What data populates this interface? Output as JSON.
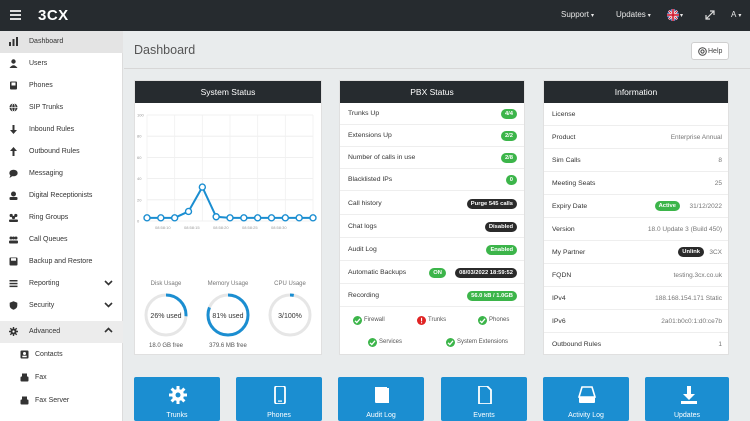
{
  "topbar": {
    "logo_number": "3",
    "logo_text": "CX",
    "support_label": "Support",
    "updates_label": "Updates",
    "user_label": "A",
    "icons": [
      "hamburger-icon",
      "uk-flag-icon",
      "expand-icon",
      "user-icon"
    ]
  },
  "sidebar": {
    "items": [
      {
        "label": "Dashboard",
        "icon": "dashboard-icon"
      },
      {
        "label": "Users",
        "icon": "user-icon"
      },
      {
        "label": "Phones",
        "icon": "phone-icon"
      },
      {
        "label": "SIP Trunks",
        "icon": "globe-icon"
      },
      {
        "label": "Inbound Rules",
        "icon": "arrow-down-icon"
      },
      {
        "label": "Outbound Rules",
        "icon": "arrow-up-icon"
      },
      {
        "label": "Messaging",
        "icon": "chat-icon"
      },
      {
        "label": "Digital Receptionists",
        "icon": "receptionist-icon"
      },
      {
        "label": "Ring Groups",
        "icon": "group-icon"
      },
      {
        "label": "Call Queues",
        "icon": "queue-icon"
      },
      {
        "label": "Backup and Restore",
        "icon": "disk-icon"
      },
      {
        "label": "Reporting",
        "icon": "report-icon"
      },
      {
        "label": "Security",
        "icon": "shield-icon"
      },
      {
        "label": "Advanced",
        "icon": "gear-icon"
      },
      {
        "label": "Contacts",
        "icon": "contacts-icon"
      },
      {
        "label": "Fax",
        "icon": "fax-icon"
      },
      {
        "label": "Fax Server",
        "icon": "fax-icon"
      }
    ]
  },
  "main": {
    "title": "Dashboard",
    "help_label": "Help"
  },
  "system_status": {
    "title": "System Status",
    "y_ticks": [
      "100",
      "80",
      "60",
      "40",
      "20",
      "0"
    ],
    "x_ticks": [
      "08:58:10",
      "08:58:15",
      "08:58:20",
      "08:58:25",
      "08:58:30"
    ],
    "gauges": [
      {
        "label": "Disk Usage",
        "value_text": "26% used",
        "percent": 26,
        "sub": "18.0 GB free"
      },
      {
        "label": "Memory Usage",
        "value_text": "81% used",
        "percent": 81,
        "sub": "379.6 MB free"
      },
      {
        "label": "CPU Usage",
        "value_text": "3/100%",
        "percent": 3,
        "sub": ""
      }
    ]
  },
  "chart_data": {
    "type": "line",
    "x": [
      "08:58:07",
      "08:58:09",
      "08:58:11",
      "08:58:13",
      "08:58:15",
      "08:58:17",
      "08:58:19",
      "08:58:21",
      "08:58:23",
      "08:58:25",
      "08:58:27",
      "08:58:29",
      "08:58:31"
    ],
    "series": [
      {
        "values": [
          3,
          3,
          3,
          9,
          32,
          4,
          3,
          3,
          3,
          3,
          3,
          3,
          3
        ]
      }
    ],
    "ylim": [
      0,
      100
    ],
    "y_ticks": [
      0,
      20,
      40,
      60,
      80,
      100
    ],
    "grid": true,
    "color": "#1b8ed1"
  },
  "pbx_status": {
    "title": "PBX Status",
    "rows": [
      {
        "label": "Trunks Up",
        "badge": "4/4",
        "style": "green"
      },
      {
        "label": "Extensions Up",
        "badge": "2/2",
        "style": "green"
      },
      {
        "label": "Number of calls in use",
        "badge": "2/8",
        "style": "green"
      },
      {
        "label": "Blacklisted IPs",
        "badge": "0",
        "style": "green"
      },
      {
        "label": "Call history",
        "badge": "Purge 545 calls",
        "style": "dark"
      },
      {
        "label": "Chat logs",
        "badge": "Disabled",
        "style": "dark"
      },
      {
        "label": "Audit Log",
        "badge": "Enabled",
        "style": "green"
      },
      {
        "label": "Automatic Backups",
        "badge": "ON",
        "badge2": "08/03/2022 18:59:52",
        "style": "green"
      },
      {
        "label": "Recording",
        "badge": "56.0 kB / 1.0GB",
        "style": "green"
      }
    ],
    "services": [
      {
        "label": "Firewall",
        "status": "ok"
      },
      {
        "label": "Trunks",
        "status": "error"
      },
      {
        "label": "Phones",
        "status": "ok"
      },
      {
        "label": "Services",
        "status": "ok"
      },
      {
        "label": "System Extensions",
        "status": "ok"
      }
    ],
    "colors": {
      "ok": "#3cb54a",
      "error": "#e02424"
    }
  },
  "information": {
    "title": "Information",
    "rows": [
      {
        "label": "License",
        "value": ""
      },
      {
        "label": "Product",
        "value": "Enterprise Annual"
      },
      {
        "label": "Sim Calls",
        "value": "8"
      },
      {
        "label": "Meeting Seats",
        "value": "25"
      },
      {
        "label": "Expiry Date",
        "badge": "Active",
        "value": "31/12/2022"
      },
      {
        "label": "Version",
        "value": "18.0 Update 3 (Build 450)"
      },
      {
        "label": "My Partner",
        "badge": "Unlink",
        "value": "3CX"
      },
      {
        "label": "FQDN",
        "value": "testing.3cx.co.uk"
      },
      {
        "label": "IPv4",
        "value": "188.168.154.171 Static"
      },
      {
        "label": "IPv6",
        "value": "2a01:b0c0:1:d0:ce7b"
      },
      {
        "label": "Outbound Rules",
        "value": "1"
      }
    ]
  },
  "tiles": [
    {
      "label": "Trunks",
      "icon": "gear-icon"
    },
    {
      "label": "Phones",
      "icon": "phone-icon"
    },
    {
      "label": "Audit Log",
      "icon": "book-icon"
    },
    {
      "label": "Events",
      "icon": "document-icon"
    },
    {
      "label": "Activity Log",
      "icon": "drive-icon"
    },
    {
      "label": "Updates",
      "icon": "download-icon"
    }
  ]
}
